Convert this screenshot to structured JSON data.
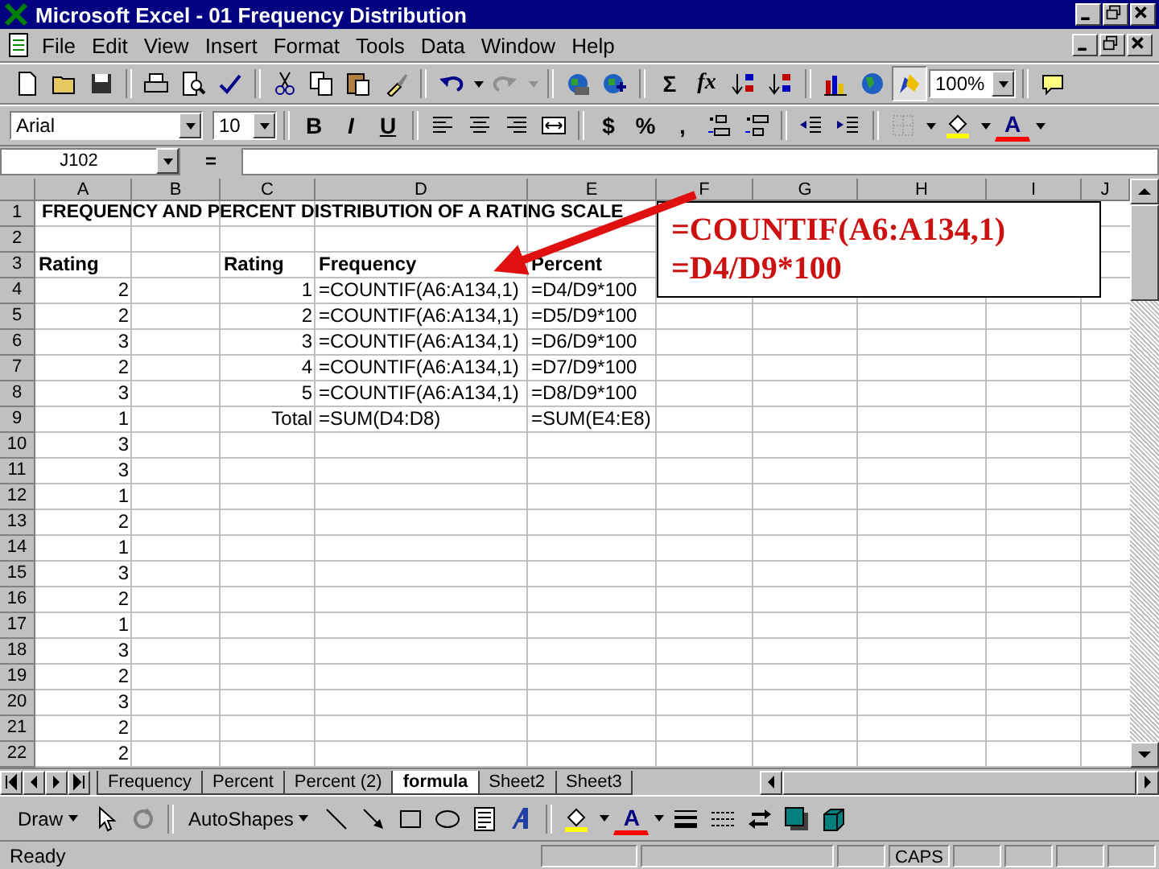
{
  "window": {
    "title": "Microsoft Excel - 01 Frequency Distribution"
  },
  "menu": [
    "File",
    "Edit",
    "View",
    "Insert",
    "Format",
    "Tools",
    "Data",
    "Window",
    "Help"
  ],
  "standard_toolbar": {
    "autosum": "Σ",
    "function": "fx",
    "zoom": "100%"
  },
  "formatting_toolbar": {
    "font": "Arial",
    "size": "10",
    "bold": "B",
    "italic": "I",
    "underline": "U",
    "currency": "$",
    "percent": "%",
    "comma": ",",
    "font_color": "A"
  },
  "formula_bar": {
    "name_box": "J102",
    "equals": "="
  },
  "sheet": {
    "columns": [
      "A",
      "B",
      "C",
      "D",
      "E",
      "F",
      "G",
      "H",
      "I",
      "J"
    ],
    "rows": [
      {
        "number": "1",
        "kind": "title",
        "cells": {
          "A": "FREQUENCY AND PERCENT DISTRIBUTION OF A RATING SCALE"
        }
      },
      {
        "number": "2",
        "cells": {}
      },
      {
        "number": "3",
        "kind": "header",
        "cells": {
          "A": "Rating",
          "C": "Rating",
          "D": "Frequency",
          "E": "Percent"
        }
      },
      {
        "number": "4",
        "cells": {
          "A": "2",
          "C": "1",
          "D": "=COUNTIF(A6:A134,1)",
          "E": "=D4/D9*100"
        }
      },
      {
        "number": "5",
        "cells": {
          "A": "2",
          "C": "2",
          "D": "=COUNTIF(A6:A134,1)",
          "E": "=D5/D9*100"
        }
      },
      {
        "number": "6",
        "cells": {
          "A": "3",
          "C": "3",
          "D": "=COUNTIF(A6:A134,1)",
          "E": "=D6/D9*100"
        }
      },
      {
        "number": "7",
        "cells": {
          "A": "2",
          "C": "4",
          "D": "=COUNTIF(A6:A134,1)",
          "E": "=D7/D9*100"
        }
      },
      {
        "number": "8",
        "cells": {
          "A": "3",
          "C": "5",
          "D": "=COUNTIF(A6:A134,1)",
          "E": "=D8/D9*100"
        }
      },
      {
        "number": "9",
        "cells": {
          "A": "1",
          "C": "Total",
          "D": "=SUM(D4:D8)",
          "E": "=SUM(E4:E8)"
        }
      },
      {
        "number": "10",
        "cells": {
          "A": "3"
        }
      },
      {
        "number": "11",
        "cells": {
          "A": "3"
        }
      },
      {
        "number": "12",
        "cells": {
          "A": "1"
        }
      },
      {
        "number": "13",
        "cells": {
          "A": "2"
        }
      },
      {
        "number": "14",
        "cells": {
          "A": "1"
        }
      },
      {
        "number": "15",
        "cells": {
          "A": "3"
        }
      },
      {
        "number": "16",
        "cells": {
          "A": "2"
        }
      },
      {
        "number": "17",
        "cells": {
          "A": "1"
        }
      },
      {
        "number": "18",
        "cells": {
          "A": "3"
        }
      },
      {
        "number": "19",
        "cells": {
          "A": "2"
        }
      },
      {
        "number": "20",
        "cells": {
          "A": "3"
        }
      },
      {
        "number": "21",
        "cells": {
          "A": "2"
        }
      },
      {
        "number": "22",
        "cells": {
          "A": "2"
        }
      }
    ]
  },
  "callout": {
    "lines": [
      "=COUNTIF(A6:A134,1)",
      "=D4/D9*100"
    ]
  },
  "sheet_tabs": [
    {
      "label": "Frequency",
      "selected": false
    },
    {
      "label": "Percent",
      "selected": false
    },
    {
      "label": "Percent (2)",
      "selected": false
    },
    {
      "label": "formula",
      "selected": true
    },
    {
      "label": "Sheet2",
      "selected": false
    },
    {
      "label": "Sheet3",
      "selected": false
    }
  ],
  "drawing_toolbar": {
    "draw": "Draw",
    "autoshapes": "AutoShapes",
    "font_color": "A"
  },
  "status_bar": {
    "message": "Ready",
    "indicators": [
      "CAPS"
    ]
  }
}
